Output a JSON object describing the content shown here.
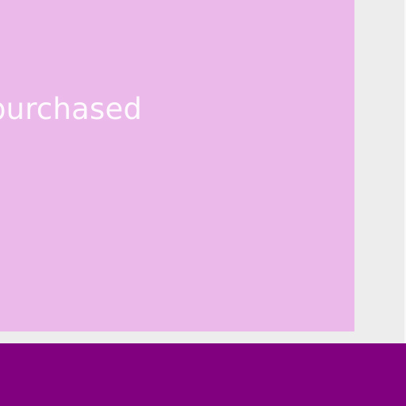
{
  "card": {
    "text": "purchased"
  },
  "colors": {
    "background": "#ededed",
    "card": "#ebbaeb",
    "card_text": "#ffffff",
    "bottom_bar": "#800080"
  }
}
